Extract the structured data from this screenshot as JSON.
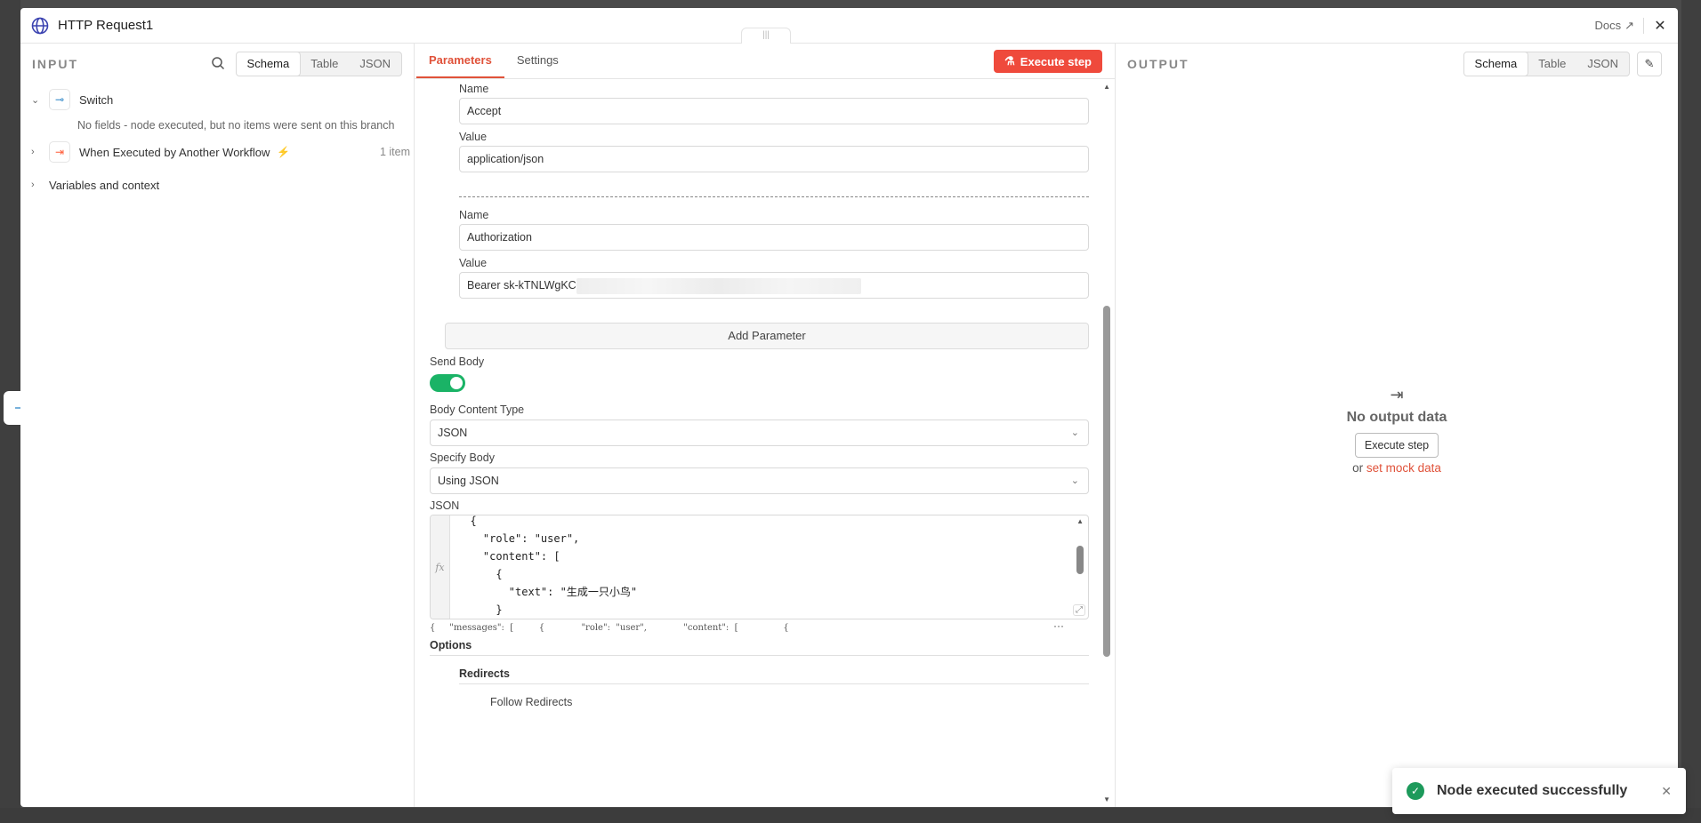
{
  "header": {
    "title": "HTTP Request1",
    "docs_label": "Docs"
  },
  "input": {
    "title": "INPUT",
    "views": [
      "Schema",
      "Table",
      "JSON"
    ],
    "tree": [
      {
        "label": "Switch",
        "note": "No fields - node executed, but no items were sent on this branch"
      },
      {
        "label": "When Executed by Another Workflow",
        "count": "1 item"
      },
      {
        "label": "Variables and context"
      }
    ]
  },
  "params": {
    "tabs": [
      "Parameters",
      "Settings"
    ],
    "execute_label": "Execute step",
    "headers": [
      {
        "name_label": "Name",
        "name_value": "Accept",
        "value_label": "Value",
        "value_value": "application/json"
      },
      {
        "name_label": "Name",
        "name_value": "Authorization",
        "value_label": "Value",
        "value_value": "Bearer sk-kTNLWgKC"
      }
    ],
    "add_parameter": "Add Parameter",
    "send_body_label": "Send Body",
    "send_body": true,
    "body_content_type_label": "Body Content Type",
    "body_content_type": "JSON",
    "specify_body_label": "Specify Body",
    "specify_body": "Using JSON",
    "json_label": "JSON",
    "json_lines": [
      "  {",
      "    \"role\": \"user\",",
      "    \"content\": [",
      "      {",
      "        \"text\": \"生成一只小鸟\"",
      "      }",
      "    ]"
    ],
    "json_preview": "{     \"messages\":  [         {             \"role\":  \"user\",             \"content\":  [                {",
    "json_preview_more": "···",
    "options_label": "Options",
    "redirects_label": "Redirects",
    "follow_redirects_label": "Follow Redirects"
  },
  "output": {
    "title": "OUTPUT",
    "views": [
      "Schema",
      "Table",
      "JSON"
    ],
    "empty_title": "No output data",
    "execute_label": "Execute step",
    "or_text": "or",
    "mock_link": "set mock data"
  },
  "toast": {
    "message": "Node executed successfully"
  }
}
